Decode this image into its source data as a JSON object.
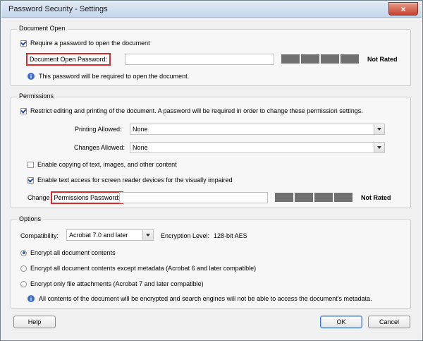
{
  "window": {
    "title": "Password Security - Settings",
    "close_glyph": "×"
  },
  "document_open": {
    "legend": "Document Open",
    "require_checkbox_label": "Require a password to open the document",
    "require_checked": true,
    "password_label": "Document Open Password:",
    "password_value": "",
    "rating": "Not Rated",
    "info_text": "This password will be required to open the document."
  },
  "permissions": {
    "legend": "Permissions",
    "restrict_label": "Restrict editing and printing of the document. A password will be required in order to change these permission settings.",
    "restrict_checked": true,
    "printing_label": "Printing Allowed:",
    "printing_value": "None",
    "changes_label": "Changes Allowed:",
    "changes_value": "None",
    "copy_label": "Enable copying of text, images, and other content",
    "copy_checked": false,
    "screenreader_label": "Enable text access for screen reader devices for the visually impaired",
    "screenreader_checked": true,
    "change_prefix": "Change",
    "perm_password_label": "Permissions Password:",
    "perm_password_value": "",
    "rating": "Not Rated"
  },
  "options": {
    "legend": "Options",
    "compat_label": "Compatibility:",
    "compat_value": "Acrobat 7.0 and later",
    "encryption_label": "Encryption  Level:",
    "encryption_value": "128-bit AES",
    "radios": [
      {
        "label": "Encrypt all document contents",
        "selected": true
      },
      {
        "label": "Encrypt all document contents except metadata (Acrobat 6 and later compatible)",
        "selected": false
      },
      {
        "label": "Encrypt only file attachments (Acrobat 7 and later compatible)",
        "selected": false
      }
    ],
    "info_text": "All contents of the document will be encrypted and search engines will not be able to access the document's metadata."
  },
  "buttons": {
    "help": "Help",
    "ok": "OK",
    "cancel": "Cancel"
  },
  "colors": {
    "highlight_box": "#d82b2b",
    "meter": "#707070",
    "info_icon": "#3e6cc6"
  },
  "icons": {
    "info": "info-icon",
    "close": "close-icon"
  },
  "glyphs": {
    "info": "i"
  }
}
